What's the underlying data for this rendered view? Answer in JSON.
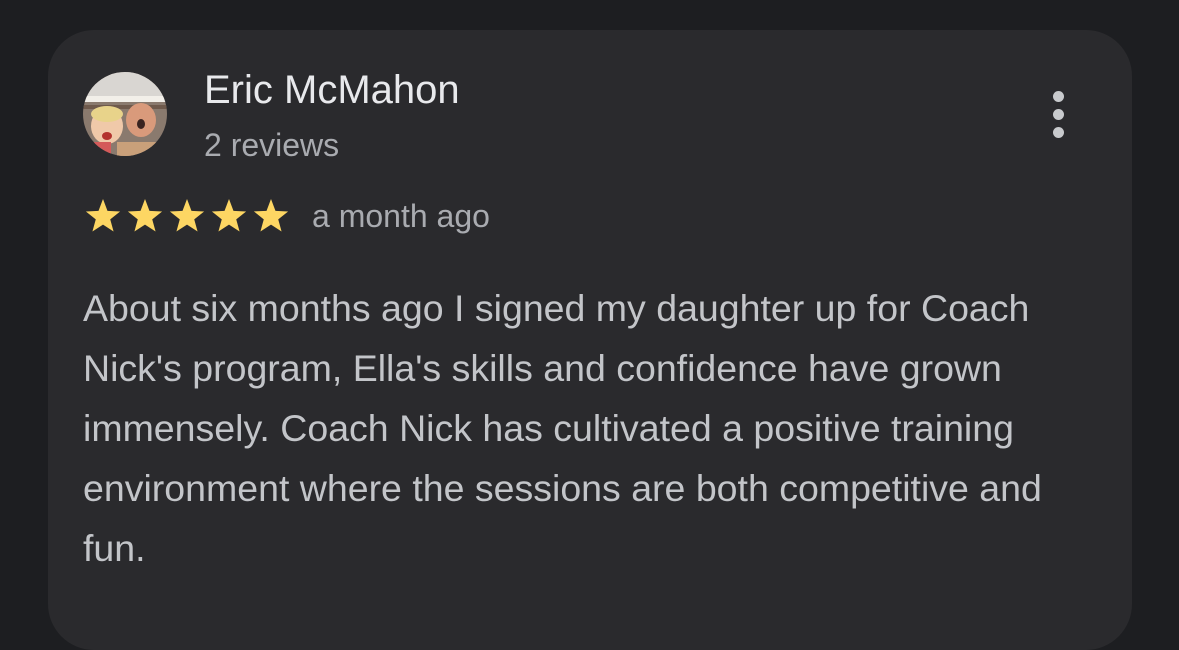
{
  "review": {
    "author": "Eric McMahon",
    "author_meta": "2 reviews",
    "rating": 5,
    "rating_max": 5,
    "date": "a month ago",
    "text": "About six months ago I signed my daughter up for Coach Nick's program, Ella's skills and confidence have grown immensely. Coach Nick has cultivated a positive training environment where the sessions are both competitive and fun."
  },
  "icons": {
    "menu": "more-vert-icon",
    "star": "star-icon"
  },
  "colors": {
    "background": "#1d1e21",
    "card": "#2a2a2d",
    "star": "#fdd663",
    "name": "#e8e9ec",
    "meta": "#a9abb0",
    "body": "#c3c5c9"
  }
}
